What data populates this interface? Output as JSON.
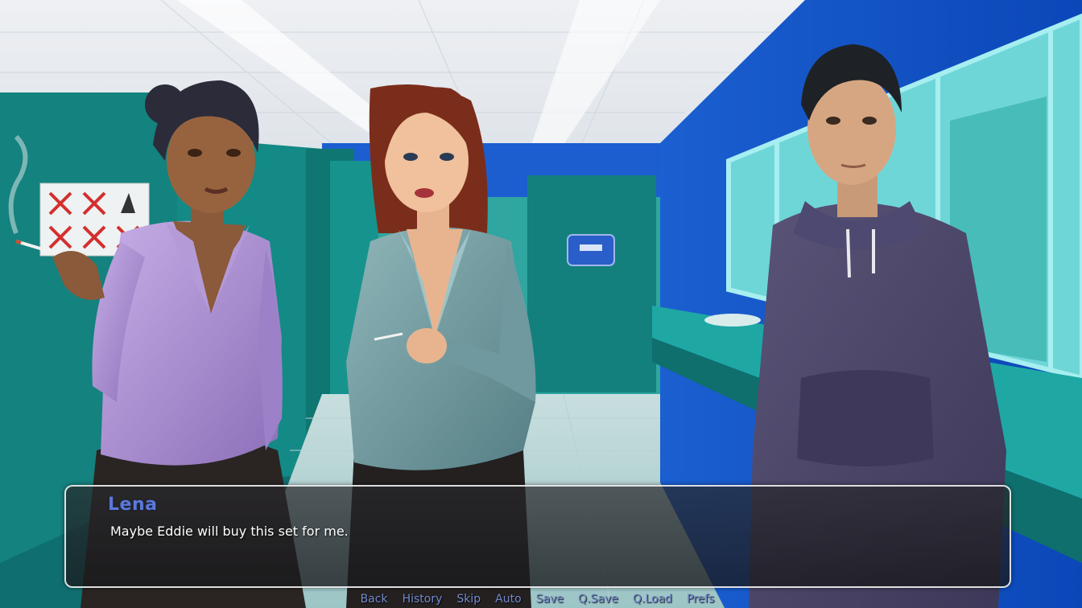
{
  "scene": {
    "description_icons": [
      "cigarette-icon",
      "no-smoking-sign-icon",
      "hand-dryer-icon"
    ]
  },
  "colors": {
    "speaker_name": "#5a79d8",
    "dialogue_text": "#ffffff",
    "quick_menu_text": "#7389cc",
    "textbox_border": "#ffffff"
  },
  "dialogue": {
    "speaker": "Lena",
    "text": "Maybe Eddie will buy this set for me."
  },
  "quick_menu": {
    "back": "Back",
    "history": "History",
    "skip": "Skip",
    "auto": "Auto",
    "save": "Save",
    "qsave": "Q.Save",
    "qload": "Q.Load",
    "prefs": "Prefs"
  }
}
